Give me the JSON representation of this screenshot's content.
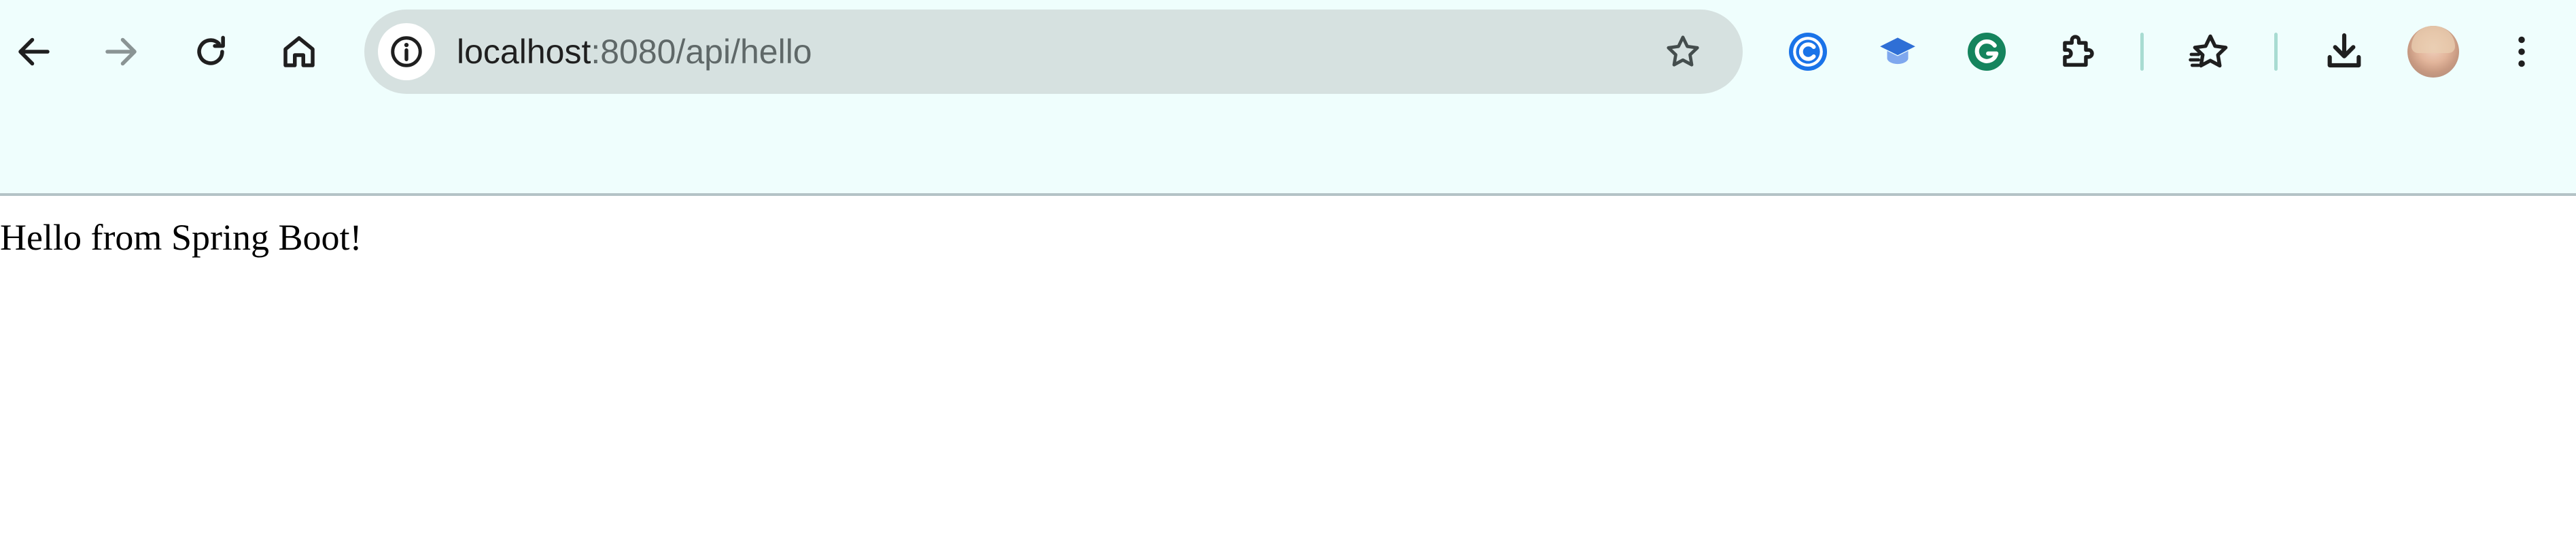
{
  "address_bar": {
    "host": "localhost",
    "path": ":8080/api/hello"
  },
  "toolbar": {
    "icons": [
      "back-icon",
      "forward-icon",
      "reload-icon",
      "home-icon",
      "site-info-icon",
      "bookmark-star-icon",
      "extension-c-icon",
      "extension-graduation-icon",
      "grammarly-icon",
      "extensions-puzzle-icon",
      "bookmarks-icon",
      "download-icon",
      "profile-avatar",
      "more-menu-icon"
    ],
    "forward_enabled": false
  },
  "page": {
    "body_text": "Hello from Spring Boot!"
  },
  "colors": {
    "chrome_background": "#effefd",
    "omnibox_background": "#d6e1e0",
    "separator": "#a8dcd2",
    "icon": "#1f1f1f",
    "icon_disabled": "#8a9494"
  }
}
